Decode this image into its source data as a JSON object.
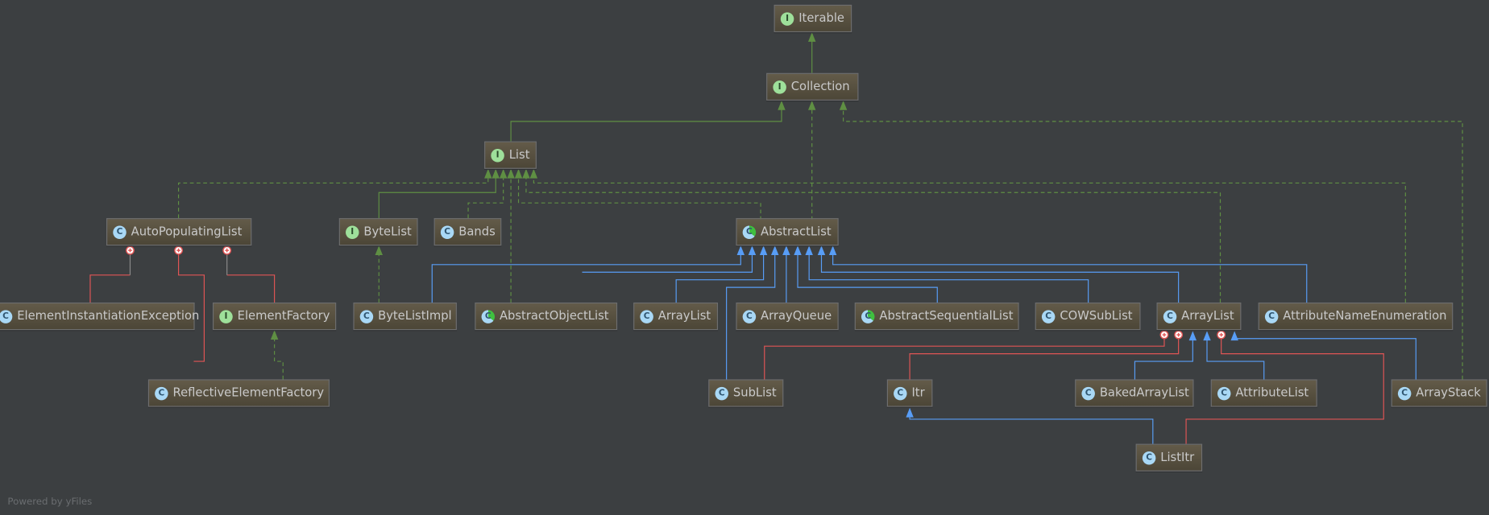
{
  "nodes": {
    "iterable": {
      "label": "Iterable",
      "kind": "interface",
      "glyph": "I"
    },
    "collection": {
      "label": "Collection",
      "kind": "interface",
      "glyph": "I"
    },
    "list": {
      "label": "List",
      "kind": "interface",
      "glyph": "I"
    },
    "auto_populating_list": {
      "label": "AutoPopulatingList",
      "kind": "class",
      "glyph": "C"
    },
    "byte_list": {
      "label": "ByteList",
      "kind": "interface",
      "glyph": "I"
    },
    "bands": {
      "label": "Bands",
      "kind": "class",
      "glyph": "C"
    },
    "abstract_list": {
      "label": "AbstractList",
      "kind": "abstract",
      "glyph": "C"
    },
    "element_instantiation_exception": {
      "label": "ElementInstantiationException",
      "kind": "class",
      "glyph": "C"
    },
    "element_factory": {
      "label": "ElementFactory",
      "kind": "interface",
      "glyph": "I"
    },
    "byte_list_impl": {
      "label": "ByteListImpl",
      "kind": "class",
      "glyph": "C"
    },
    "abstract_object_list": {
      "label": "AbstractObjectList",
      "kind": "abstract",
      "glyph": "C"
    },
    "array_list_inner": {
      "label": "ArrayList",
      "kind": "class",
      "glyph": "C"
    },
    "array_queue": {
      "label": "ArrayQueue",
      "kind": "class",
      "glyph": "C"
    },
    "abstract_sequential_list": {
      "label": "AbstractSequentialList",
      "kind": "abstract",
      "glyph": "C"
    },
    "cow_sub_list": {
      "label": "COWSubList",
      "kind": "class",
      "glyph": "C"
    },
    "array_list": {
      "label": "ArrayList",
      "kind": "class",
      "glyph": "C"
    },
    "attribute_name_enumeration": {
      "label": "AttributeNameEnumeration",
      "kind": "class",
      "glyph": "C"
    },
    "reflective_element_factory": {
      "label": "ReflectiveElementFactory",
      "kind": "class",
      "glyph": "C"
    },
    "sub_list": {
      "label": "SubList",
      "kind": "class",
      "glyph": "C"
    },
    "itr": {
      "label": "Itr",
      "kind": "class",
      "glyph": "C"
    },
    "baked_array_list": {
      "label": "BakedArrayList",
      "kind": "class",
      "glyph": "C"
    },
    "attribute_list": {
      "label": "AttributeList",
      "kind": "class",
      "glyph": "C"
    },
    "array_stack": {
      "label": "ArrayStack",
      "kind": "class",
      "glyph": "C"
    },
    "list_itr": {
      "label": "ListItr",
      "kind": "class",
      "glyph": "C"
    }
  },
  "footer": "Powered by yFiles",
  "colors": {
    "background": "#3c3f41",
    "interface_inheritance": "#5f8f43",
    "class_inheritance": "#589df6",
    "inner_class": "#e05555",
    "node_fill": "#5a5444"
  }
}
